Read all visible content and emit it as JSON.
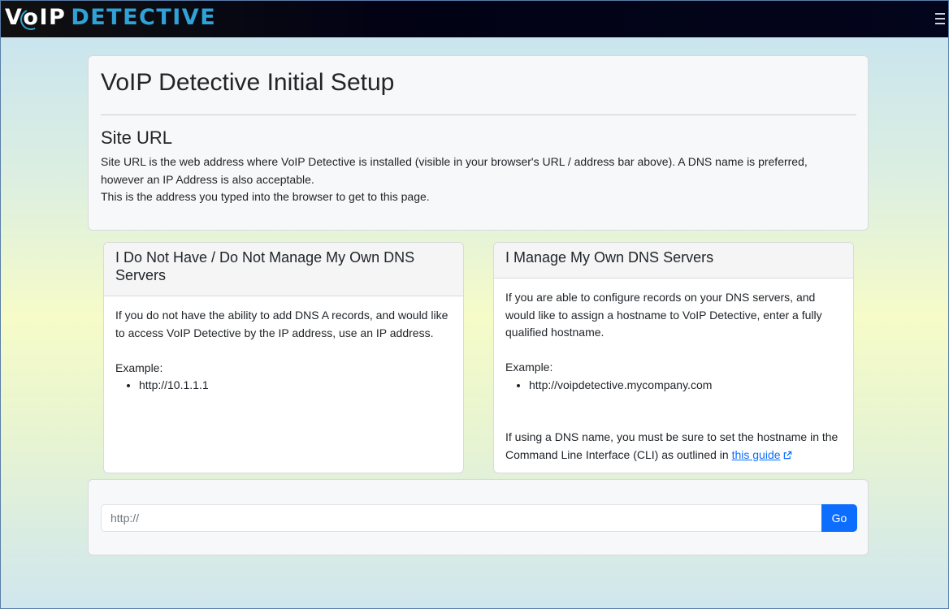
{
  "header": {
    "logo_text_1": "V",
    "logo_text_o": "o",
    "logo_text_2": "IP",
    "logo_text_3": "DETECTIVE",
    "menu_icon": "hamburger-menu-icon"
  },
  "setup": {
    "title": "VoIP Detective Initial Setup",
    "section_title": "Site URL",
    "line1": "Site URL is the web address where VoIP Detective is installed (visible in your browser's URL / address bar above). A DNS name is preferred, however an IP Address is also acceptable.",
    "line2": "This is the address you typed into the browser to get to this page."
  },
  "no_dns": {
    "title": "I Do Not Have / Do Not Manage My Own DNS Servers",
    "body": "If you do not have the ability to add DNS A records, and would like to access VoIP Detective by the IP address, use an IP address.",
    "example_label": "Example:",
    "example_value": "http://10.1.1.1"
  },
  "own_dns": {
    "title": "I Manage My Own DNS Servers",
    "body": "If you are able to configure records on your DNS servers, and would like to assign a hostname to VoIP Detective, enter a fully qualified hostname.",
    "example_label": "Example:",
    "example_value": "http://voipdetective.mycompany.com",
    "note_prefix": "If using a DNS name, you must be sure to set the hostname in the Command Line Interface (CLI) as outlined in",
    "guide_link": "this guide",
    "link_icon": "external-link-icon"
  },
  "url_form": {
    "value": "",
    "placeholder": "http://",
    "go_label": "Go"
  },
  "colors": {
    "accent": "#0d6efd",
    "logo_blue": "#2fa3d8",
    "navbar": "#03051c"
  }
}
